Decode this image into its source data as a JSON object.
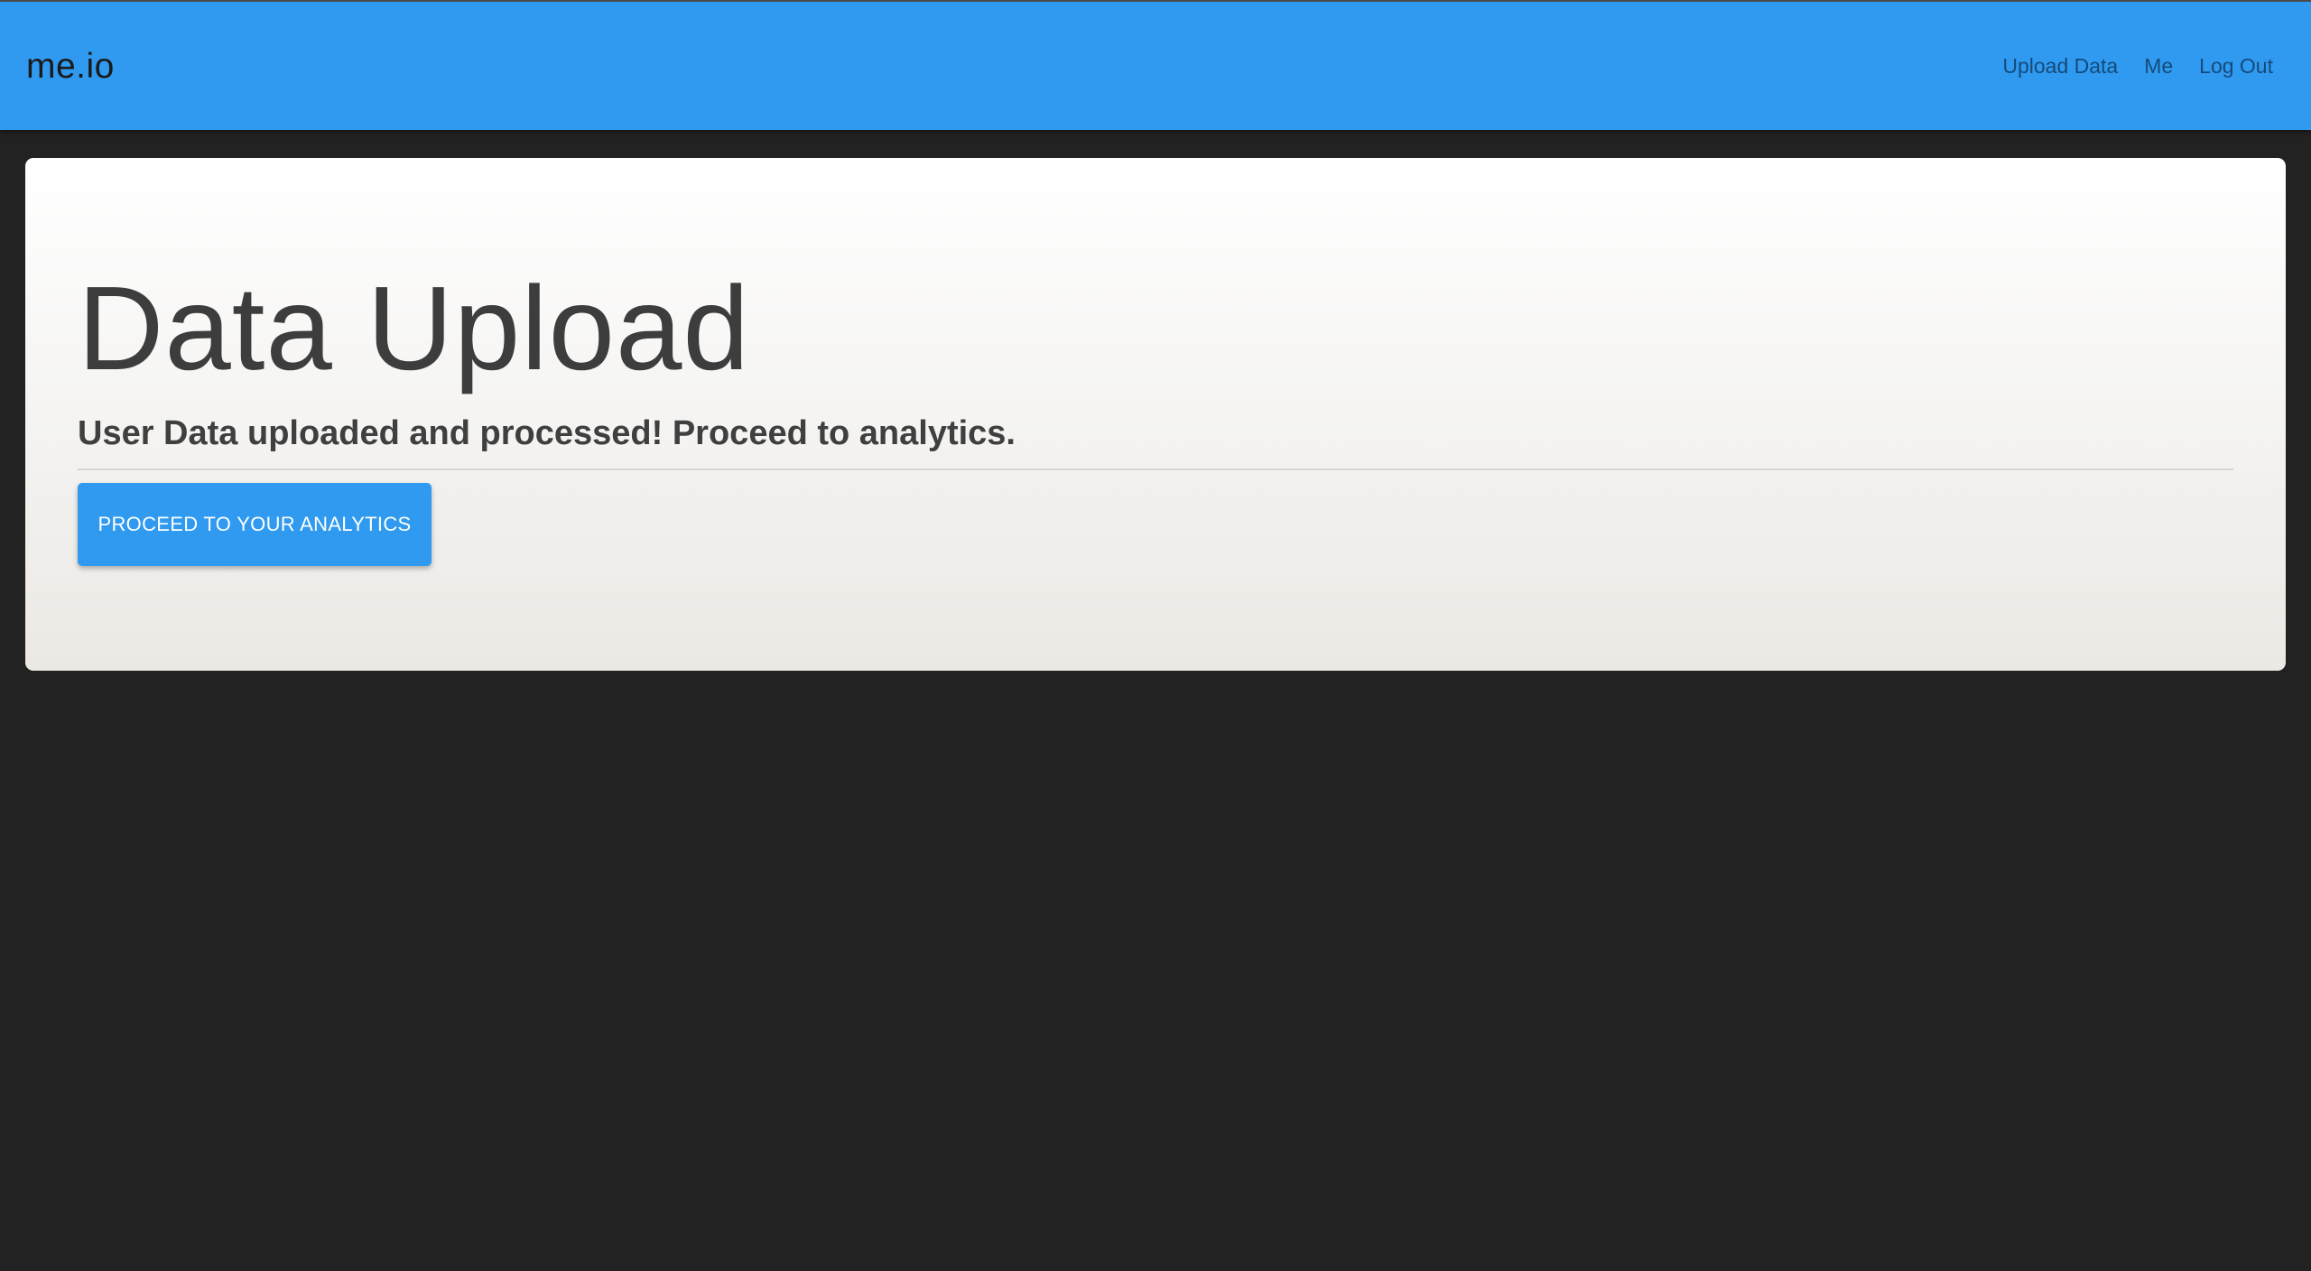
{
  "navbar": {
    "brand": "me.io",
    "links": [
      {
        "label": "Upload Data"
      },
      {
        "label": "Me"
      },
      {
        "label": "Log Out"
      }
    ]
  },
  "main": {
    "title": "Data Upload",
    "subtitle": "User Data uploaded and processed! Proceed to analytics.",
    "button_label": "PROCEED TO YOUR ANALYTICS"
  },
  "colors": {
    "navbar_bg": "#2f9af0",
    "page_bg": "#222222",
    "button_bg": "#2f9af0",
    "button_text": "#ffffff",
    "heading_text": "#3d3d3d"
  }
}
